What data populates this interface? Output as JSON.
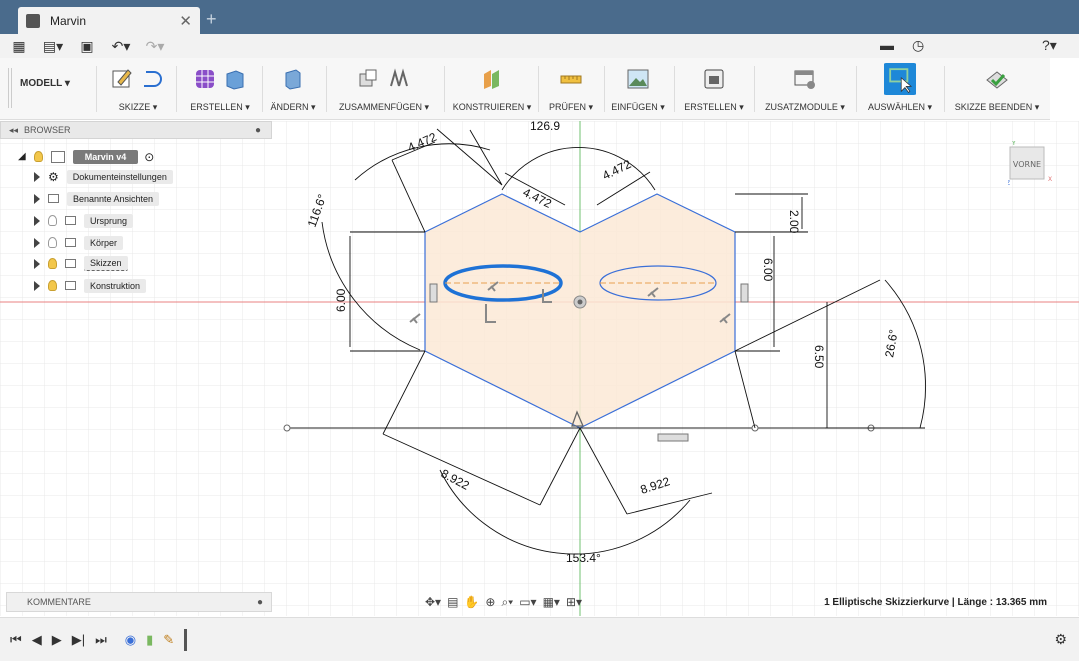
{
  "window": {
    "tab_title": "Marvin"
  },
  "ribbon": {
    "workspace": "MODELL ▾",
    "groups": [
      {
        "label": "SKIZZE ▾"
      },
      {
        "label": "ERSTELLEN ▾"
      },
      {
        "label": "ÄNDERN ▾"
      },
      {
        "label": "ZUSAMMENFÜGEN ▾"
      },
      {
        "label": "KONSTRUIEREN ▾"
      },
      {
        "label": "PRÜFEN ▾"
      },
      {
        "label": "EINFÜGEN ▾"
      },
      {
        "label": "ERSTELLEN ▾"
      },
      {
        "label": "ZUSATZMODULE ▾"
      },
      {
        "label": "AUSWÄHLEN ▾"
      },
      {
        "label": "SKIZZE BEENDEN ▾"
      }
    ]
  },
  "browser": {
    "title": "BROWSER",
    "root": "Marvin v4",
    "items": [
      {
        "label": "Dokumenteinstellungen"
      },
      {
        "label": "Benannte Ansichten"
      },
      {
        "label": "Ursprung"
      },
      {
        "label": "Körper"
      },
      {
        "label": "Skizzen"
      },
      {
        "label": "Konstruktion"
      }
    ]
  },
  "viewcube": {
    "face": "VORNE",
    "axis_x": "X",
    "axis_y": "Y",
    "axis_z": "Z"
  },
  "dimensions": {
    "top_width": "126.9",
    "left_edge": "4.472",
    "left_inner": "4.472",
    "right_inner": "4.472",
    "angle_left": "116.6°",
    "height_top": "2.00",
    "height_mid": "6.00",
    "height_left": "6.00",
    "height_right": "6.50",
    "angle_right": "26.6°",
    "bottom_left": "8.922",
    "bottom_right": "8.922",
    "angle_bottom": "153.4°"
  },
  "comments": {
    "label": "KOMMENTARE"
  },
  "status": {
    "text": "1 Elliptische Skizzierkurve | Länge : 13.365 mm"
  },
  "colors": {
    "titlebar": "#4a6b8c",
    "sketch_fill": "#fbe9d6",
    "sketch_line": "#3a6fd8",
    "selection": "#1e72d6",
    "axis_red": "#e07070",
    "axis_green": "#55b055"
  }
}
